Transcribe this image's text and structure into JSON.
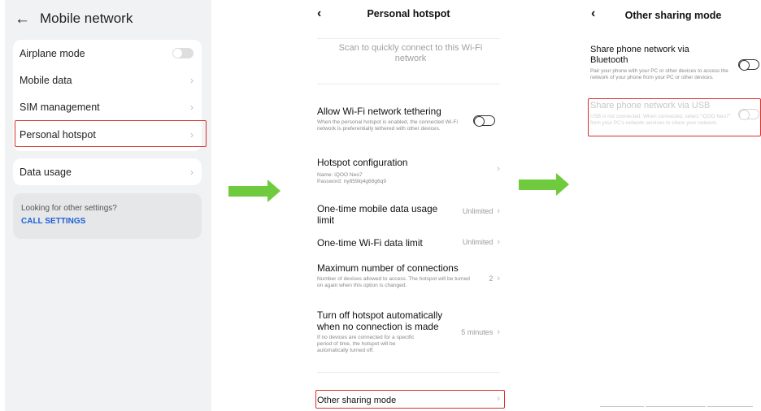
{
  "panel1": {
    "title": "Mobile network",
    "back_icon": "arrow-left-icon",
    "items": [
      {
        "label": "Airplane mode",
        "control": "toggle-off"
      },
      {
        "label": "Mobile data",
        "control": "chevron"
      },
      {
        "label": "SIM management",
        "control": "chevron"
      },
      {
        "label": "Personal hotspot",
        "control": "chevron"
      }
    ],
    "data_usage": {
      "label": "Data usage"
    },
    "other_settings": {
      "question": "Looking for other settings?",
      "link": "CALL SETTINGS"
    },
    "chevron": "›"
  },
  "panel2": {
    "title": "Personal hotspot",
    "back": "‹",
    "scan_text": "Scan to quickly connect to this Wi-Fi network",
    "tethering": {
      "title": "Allow Wi-Fi network tethering",
      "desc": "When the personal hotspot is enabled, the connected Wi-Fi network is preferentially tethered with other devices."
    },
    "config": {
      "title": "Hotspot configuration",
      "name_line": "Name: iQOO Neo7",
      "password_line": "Password: ny859lq4g68g6q9"
    },
    "mobile_limit": {
      "title": "One-time mobile data usage limit",
      "value": "Unlimited"
    },
    "wifi_limit": {
      "title": "One-time Wi-Fi data limit",
      "value": "Unlimited"
    },
    "max_conn": {
      "title": "Maximum number of connections",
      "desc": "Number of devices allowed to access. The hotspot will be turned on again when this option is changed.",
      "value": "2"
    },
    "auto_off": {
      "title": "Turn off hotspot automatically when no connection is made",
      "desc": "If no devices are connected for a specific period of time, the hotspot will be automatically turned off.",
      "value": "5 minutes"
    },
    "other_mode": {
      "title": "Other sharing mode"
    },
    "chevron": "›"
  },
  "panel3": {
    "title": "Other sharing mode",
    "back": "‹",
    "bluetooth": {
      "title": "Share phone network via Bluetooth",
      "desc": "Pair your phone with your PC or other devices to access the network of your phone from your PC or other devices."
    },
    "usb": {
      "title": "Share phone network via USB",
      "desc": "USB is not connected. When connected, select \"iQOO Neo7\" from your PC's network services to share your network."
    }
  },
  "colors": {
    "highlight": "#d9302a",
    "arrow": "#6fca3e",
    "link": "#1f5fd6",
    "panel1_bg": "#f1f2f4"
  }
}
